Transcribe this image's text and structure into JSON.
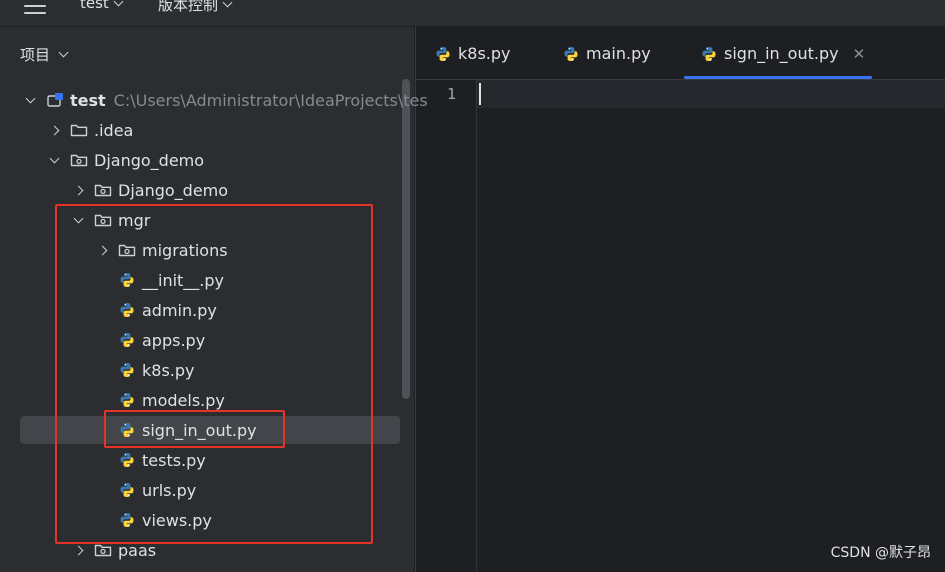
{
  "topbar": {
    "menus": [
      {
        "label": "test"
      },
      {
        "label": "版本控制"
      }
    ]
  },
  "project_panel": {
    "title": "项目",
    "root": {
      "name": "test",
      "path": "C:\\Users\\Administrator\\IdeaProjects\\tes"
    },
    "items": [
      {
        "label": ".idea"
      },
      {
        "label": "Django_demo"
      },
      {
        "label": "Django_demo"
      },
      {
        "label": "mgr"
      },
      {
        "label": "migrations"
      },
      {
        "label": "__init__.py"
      },
      {
        "label": "admin.py"
      },
      {
        "label": "apps.py"
      },
      {
        "label": "k8s.py"
      },
      {
        "label": "models.py"
      },
      {
        "label": "sign_in_out.py"
      },
      {
        "label": "tests.py"
      },
      {
        "label": "urls.py"
      },
      {
        "label": "views.py"
      },
      {
        "label": "paas"
      }
    ]
  },
  "editor": {
    "tabs": [
      {
        "label": "k8s.py"
      },
      {
        "label": "main.py"
      },
      {
        "label": "sign_in_out.py"
      }
    ],
    "active_tab": "sign_in_out.py",
    "line_numbers": [
      "1"
    ]
  },
  "icons": {
    "python": "python-file-icon",
    "folder": "folder-icon",
    "package": "package-folder-icon",
    "project": "project-icon"
  },
  "colors": {
    "accent": "#3574f0",
    "highlight_box": "#e53328",
    "python_blue": "#3c78aa",
    "python_yellow": "#ffd43b"
  },
  "watermark": "CSDN @默子昂"
}
